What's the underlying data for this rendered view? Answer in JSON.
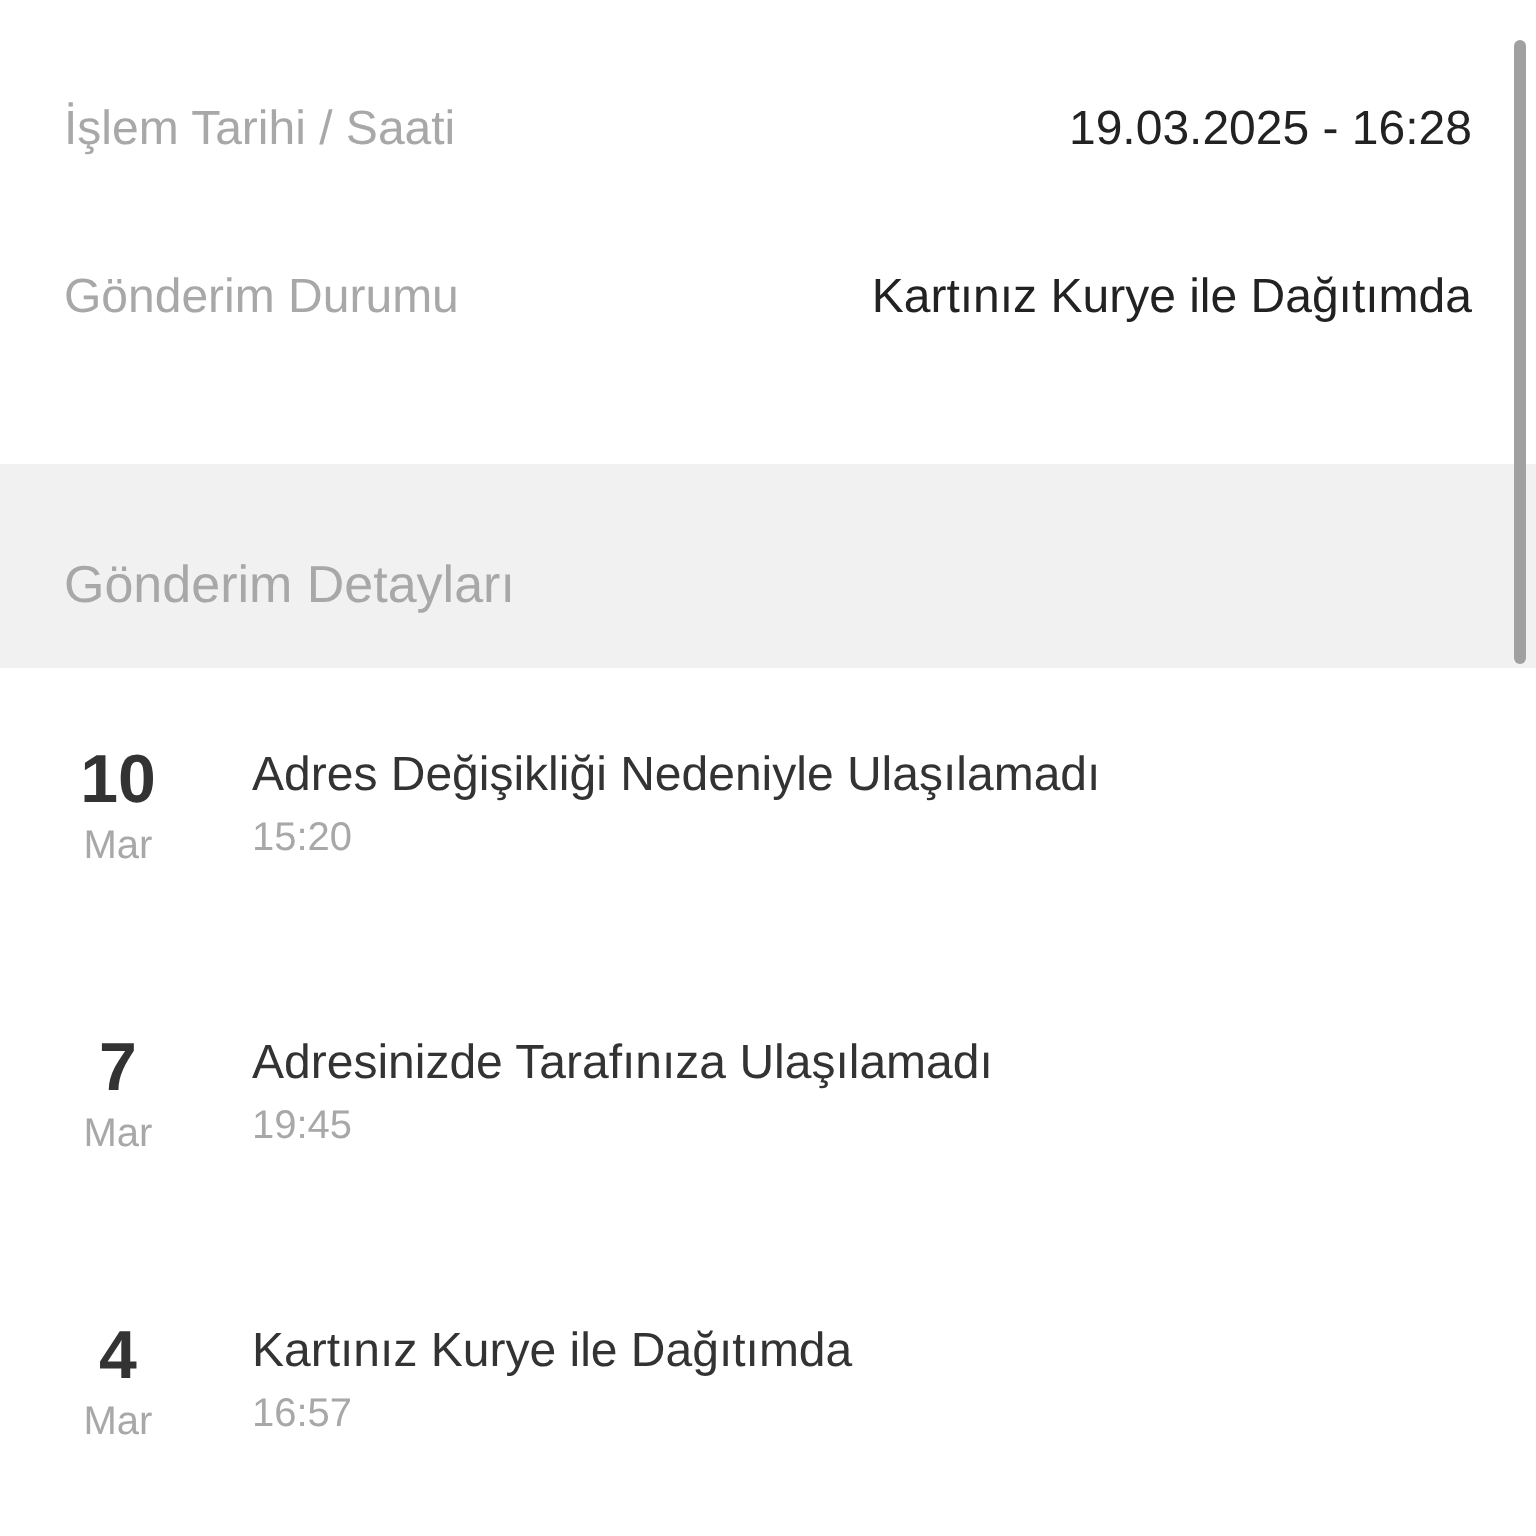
{
  "info_rows": [
    {
      "label": "İşlem Tarihi / Saati",
      "value": "19.03.2025 - 16:28"
    },
    {
      "label": "Gönderim Durumu",
      "value": "Kartınız Kurye ile Dağıtımda"
    }
  ],
  "section": {
    "title": "Gönderim Detayları"
  },
  "events": [
    {
      "day": "10",
      "month": "Mar",
      "title": "Adres Değişikliği Nedeniyle Ulaşılamadı",
      "time": "15:20"
    },
    {
      "day": "7",
      "month": "Mar",
      "title": "Adresinizde Tarafınıza Ulaşılamadı",
      "time": "19:45"
    },
    {
      "day": "4",
      "month": "Mar",
      "title": "Kartınız Kurye ile Dağıtımda",
      "time": "16:57"
    }
  ]
}
